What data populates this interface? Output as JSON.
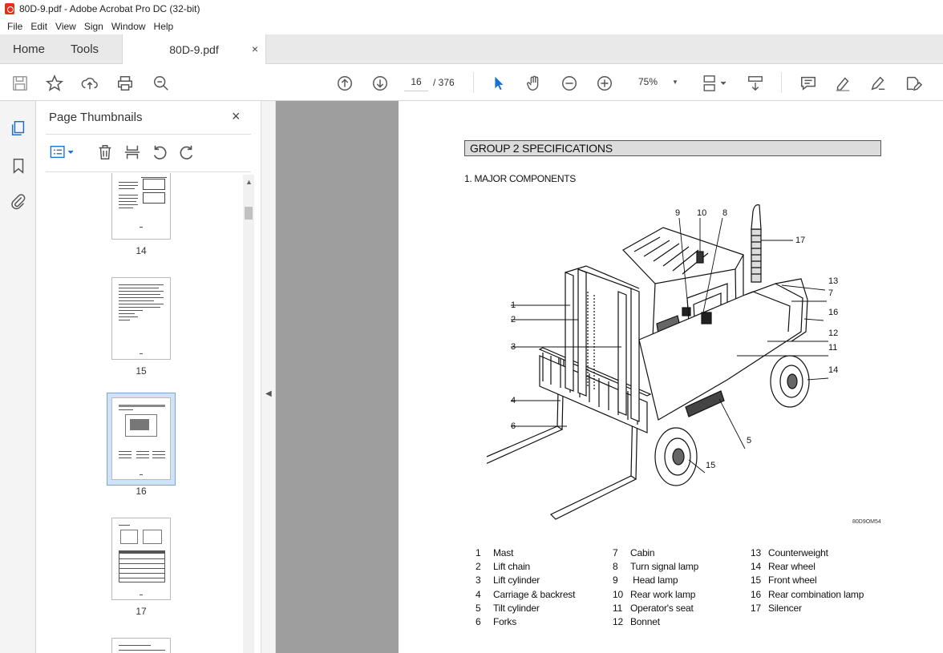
{
  "window": {
    "title": "80D-9.pdf - Adobe Acrobat Pro DC (32-bit)"
  },
  "menu": [
    "File",
    "Edit",
    "View",
    "Sign",
    "Window",
    "Help"
  ],
  "tabs": {
    "home": "Home",
    "tools": "Tools",
    "document": "80D-9.pdf",
    "close": "×"
  },
  "toolbar": {
    "current_page": "16",
    "total_pages": "/ 376",
    "zoom": "75%"
  },
  "thumbnails": {
    "title": "Page Thumbnails",
    "close": "×",
    "pages": [
      "14",
      "15",
      "16",
      "17"
    ],
    "selected": "16"
  },
  "page": {
    "group_header": "GROUP 2  SPECIFICATIONS",
    "section_title": "1. MAJOR COMPONENTS",
    "figure_code": "80D9OM54",
    "callouts": [
      "1",
      "2",
      "3",
      "4",
      "6",
      "9",
      "10",
      "8",
      "17",
      "13",
      "7",
      "16",
      "12",
      "11",
      "14",
      "5",
      "15"
    ],
    "components": [
      {
        "num": "1",
        "name": "Mast"
      },
      {
        "num": "2",
        "name": "Lift chain"
      },
      {
        "num": "3",
        "name": "Lift cylinder"
      },
      {
        "num": "4",
        "name": "Carriage & backrest"
      },
      {
        "num": "5",
        "name": "Tilt cylinder"
      },
      {
        "num": "6",
        "name": "Forks"
      },
      {
        "num": "7",
        "name": "Cabin"
      },
      {
        "num": "8",
        "name": "Turn signal lamp"
      },
      {
        "num": "9",
        "name": " Head lamp"
      },
      {
        "num": "10",
        "name": "Rear work lamp"
      },
      {
        "num": "11",
        "name": "Operator's seat"
      },
      {
        "num": "12",
        "name": "Bonnet"
      },
      {
        "num": "13",
        "name": "Counterweight"
      },
      {
        "num": "14",
        "name": "Rear wheel"
      },
      {
        "num": "15",
        "name": "Front wheel"
      },
      {
        "num": "16",
        "name": "Rear combination lamp"
      },
      {
        "num": "17",
        "name": "Silencer"
      }
    ]
  }
}
